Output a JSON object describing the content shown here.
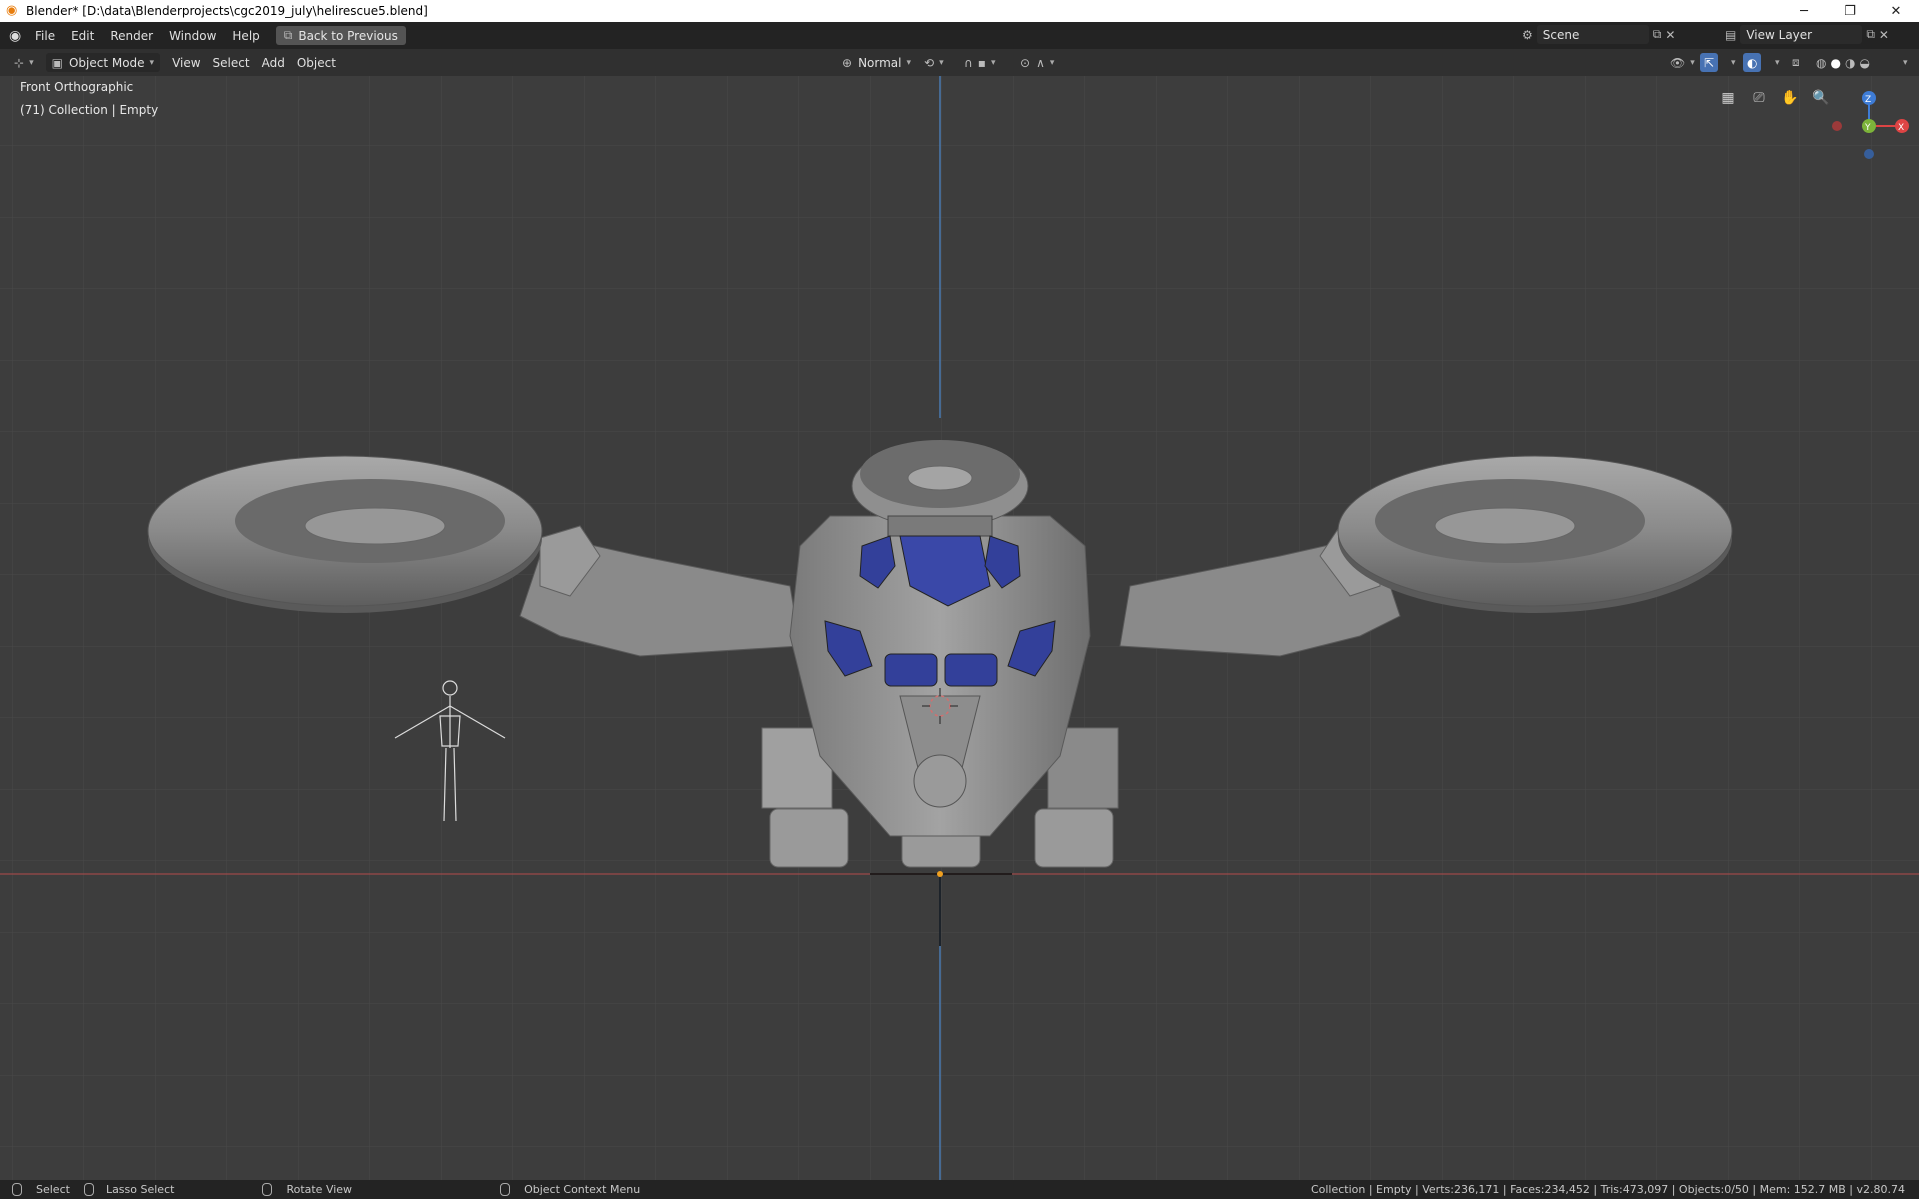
{
  "window": {
    "title": "Blender* [D:\\data\\Blenderprojects\\cgc2019_july\\helirescue5.blend]",
    "controls": [
      "─",
      "❐",
      "✕"
    ]
  },
  "topbar": {
    "menus": [
      "File",
      "Edit",
      "Render",
      "Window",
      "Help"
    ],
    "back_button": "Back to Previous",
    "scene": "Scene",
    "view_layer": "View Layer"
  },
  "header": {
    "mode": "Object Mode",
    "menus": [
      "View",
      "Select",
      "Add",
      "Object"
    ],
    "orientation": "Normal"
  },
  "viewport": {
    "view_name": "Front Orthographic",
    "collection_info": "(71) Collection | Empty",
    "gizmo": {
      "z": "Z",
      "y": "Y",
      "x": "X"
    },
    "nav_icons": [
      "grid-icon",
      "camera-icon",
      "hand-icon",
      "zoom-icon"
    ]
  },
  "statusbar": {
    "select": "Select",
    "lasso": "Lasso Select",
    "rotate": "Rotate View",
    "context_menu": "Object Context Menu",
    "stats": "Collection | Empty | Verts:236,171 | Faces:234,452 | Tris:473,097 | Objects:0/50 | Mem: 152.7 MB | v2.80.74"
  },
  "colors": {
    "viewport_bg": "#3d3d3d",
    "grid_line": "#4a4a4a",
    "axis_x": "#9c4a4a",
    "axis_z": "#4a7ab0",
    "accent_blue": "#4772b3",
    "model_gray": "#8e8e8e",
    "cockpit_glass": "#33409a"
  }
}
